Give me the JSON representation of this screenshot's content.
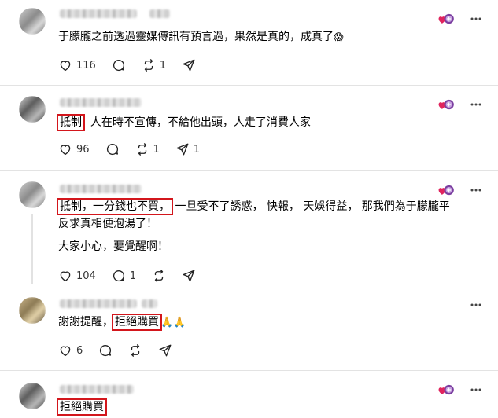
{
  "posts": [
    {
      "text_segments": [
        "于朦朧之前透過靈媒傳訊有預言過，果然是真的，成真了"
      ],
      "emoji": "😱",
      "actions": {
        "likes": "116",
        "reposts": "1"
      }
    },
    {
      "highlight": "抵制",
      "text": "人在時不宣傳，不給他出頭，人走了消費人家",
      "actions": {
        "likes": "96",
        "reposts": "1",
        "shares": "1"
      }
    },
    {
      "highlight": "抵制，一分錢也不買，",
      "line1_rest": "一旦受不了誘惑， 快報， 天娛得益， 那我們為于朦朧平",
      "line2": "反求真相便泡湯了！",
      "line3": "大家小心，要覺醒啊！",
      "actions": {
        "likes": "104",
        "comments": "1"
      }
    },
    {
      "text_prefix": "謝謝提醒，",
      "highlight": "拒絕購買",
      "emoji": "🙏🙏",
      "actions": {
        "likes": "6"
      }
    },
    {
      "highlight": "拒絕購買"
    }
  ],
  "icons": {
    "reaction": "heart-reaction-icon",
    "more": "more-options-icon",
    "like": "heart-icon",
    "comment": "comment-icon",
    "repost": "repost-icon",
    "share": "share-icon"
  },
  "colors": {
    "highlight_box": "#d3161c"
  }
}
